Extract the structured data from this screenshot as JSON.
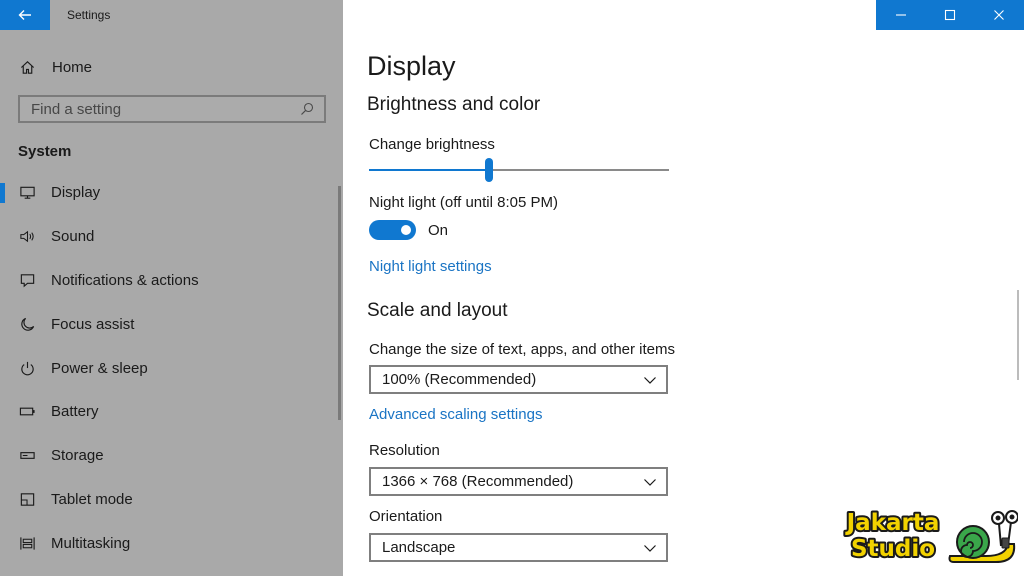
{
  "window": {
    "title": "Settings",
    "accent": "#1078d0"
  },
  "sidebar": {
    "home_label": "Home",
    "search_placeholder": "Find a setting",
    "section": "System",
    "items": [
      {
        "label": "Display",
        "icon": "display-icon",
        "active": true
      },
      {
        "label": "Sound",
        "icon": "speaker-icon"
      },
      {
        "label": "Notifications & actions",
        "icon": "notifications-icon"
      },
      {
        "label": "Focus assist",
        "icon": "moon-icon"
      },
      {
        "label": "Power & sleep",
        "icon": "power-icon"
      },
      {
        "label": "Battery",
        "icon": "battery-icon"
      },
      {
        "label": "Storage",
        "icon": "storage-icon"
      },
      {
        "label": "Tablet mode",
        "icon": "tablet-icon"
      },
      {
        "label": "Multitasking",
        "icon": "multitasking-icon"
      }
    ]
  },
  "main": {
    "title": "Display",
    "brightness_section": "Brightness and color",
    "brightness_label": "Change brightness",
    "brightness_value": 0.4,
    "night_light_label": "Night light (off until 8:05 PM)",
    "night_light_state": "On",
    "night_light_link": "Night light settings",
    "scale_section": "Scale and layout",
    "scale_label": "Change the size of text, apps, and other items",
    "scale_value": "100% (Recommended)",
    "advanced_scaling_link": "Advanced scaling settings",
    "resolution_label": "Resolution",
    "resolution_value": "1366 × 768 (Recommended)",
    "orientation_label": "Orientation",
    "orientation_value": "Landscape"
  },
  "watermark": {
    "line1": "Jakarta",
    "line2": "Studio"
  }
}
